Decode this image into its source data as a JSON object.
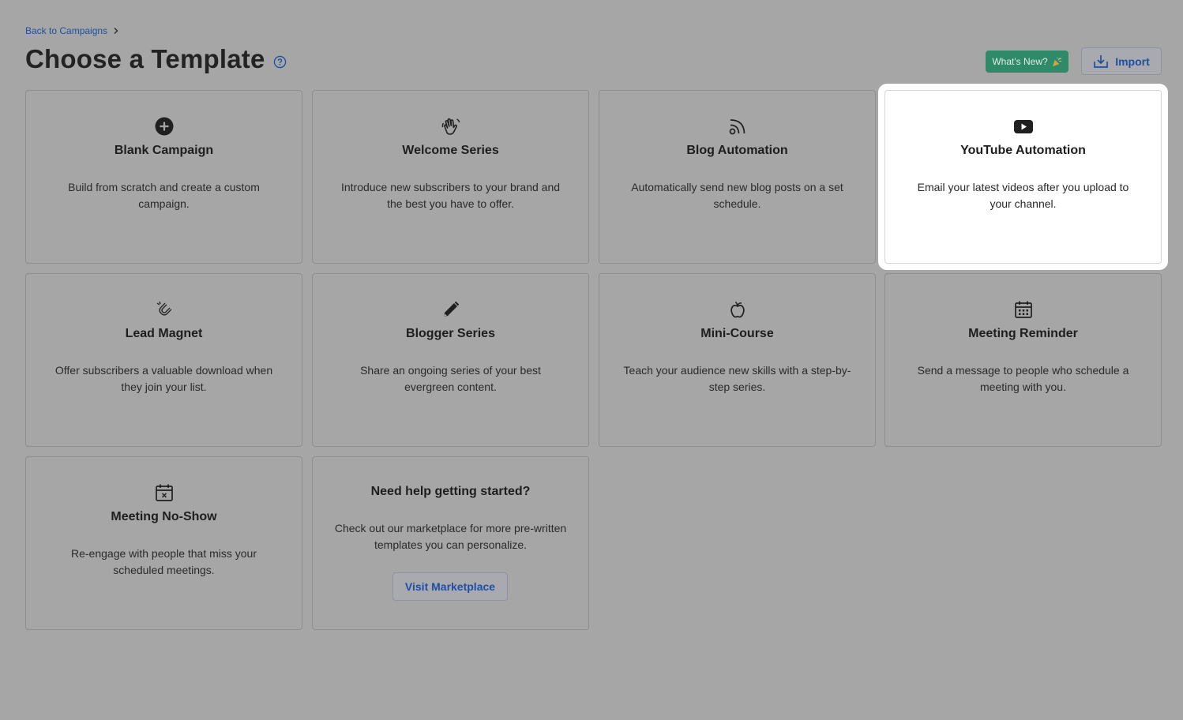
{
  "breadcrumb": {
    "back_label": "Back to Campaigns"
  },
  "header": {
    "title": "Choose a Template",
    "whats_new_label": "What's New?",
    "import_label": "Import"
  },
  "cards": [
    {
      "title": "Blank Campaign",
      "desc": "Build from scratch and create a custom campaign.",
      "icon": "plus-circle-icon"
    },
    {
      "title": "Welcome Series",
      "desc": "Introduce new subscribers to your brand and the best you have to offer.",
      "icon": "waving-hand-icon"
    },
    {
      "title": "Blog Automation",
      "desc": "Automatically send new blog posts on a set schedule.",
      "icon": "rss-icon"
    },
    {
      "title": "YouTube Automation",
      "desc": "Email your latest videos after you upload to your channel.",
      "icon": "youtube-icon"
    },
    {
      "title": "Lead Magnet",
      "desc": "Offer subscribers a valuable download when they join your list.",
      "icon": "magnet-icon"
    },
    {
      "title": "Blogger Series",
      "desc": "Share an ongoing series of your best evergreen content.",
      "icon": "pencil-icon"
    },
    {
      "title": "Mini-Course",
      "desc": "Teach your audience new skills with a step-by-step series.",
      "icon": "apple-icon"
    },
    {
      "title": "Meeting Reminder",
      "desc": "Send a message to people who schedule a meeting with you.",
      "icon": "calendar-icon"
    },
    {
      "title": "Meeting No-Show",
      "desc": "Re-engage with people that miss your scheduled meetings.",
      "icon": "calendar-x-icon"
    }
  ],
  "help_card": {
    "title": "Need help getting started?",
    "desc": "Check out our marketplace for more pre-written templates you can personalize.",
    "button_label": "Visit Marketplace"
  },
  "colors": {
    "link": "#1f4fa0",
    "whats_new_bg": "#2f8a6a",
    "overlay_bg": "#a6a6a6",
    "highlight_card_bg": "#ffffff"
  }
}
